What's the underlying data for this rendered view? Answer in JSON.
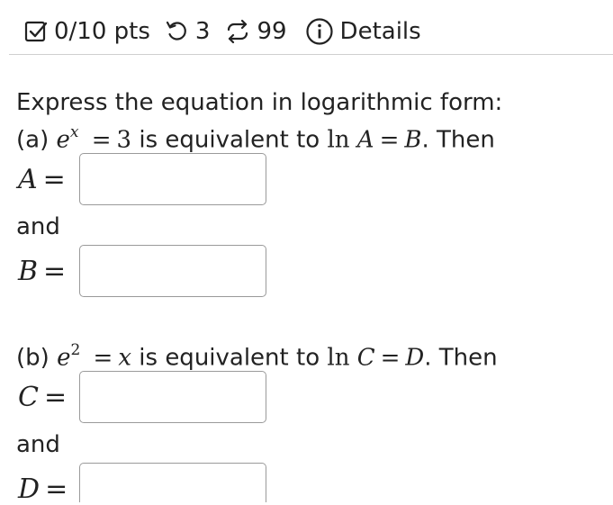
{
  "header": {
    "score": "0/10 pts",
    "attempts": "3",
    "submissions": "99",
    "details": "Details"
  },
  "question": {
    "prompt": "Express the equation in logarithmic form:",
    "a": {
      "label": "(a)",
      "base": "e",
      "exp": "x",
      "eq": "=",
      "val": "3",
      "mid": "is equivalent to",
      "ln": "ln",
      "v1": "A",
      "v2": "B",
      "tail": ". Then"
    },
    "b": {
      "label": "(b)",
      "base": "e",
      "exp": "2",
      "eq": "=",
      "val": "x",
      "mid": "is equivalent to",
      "ln": "ln",
      "v1": "C",
      "v2": "D",
      "tail": ". Then"
    },
    "and": "and",
    "answers": [
      {
        "var": "A",
        "eq": "=",
        "value": ""
      },
      {
        "var": "B",
        "eq": "=",
        "value": ""
      },
      {
        "var": "C",
        "eq": "=",
        "value": ""
      },
      {
        "var": "D",
        "eq": "=",
        "value": ""
      }
    ]
  }
}
